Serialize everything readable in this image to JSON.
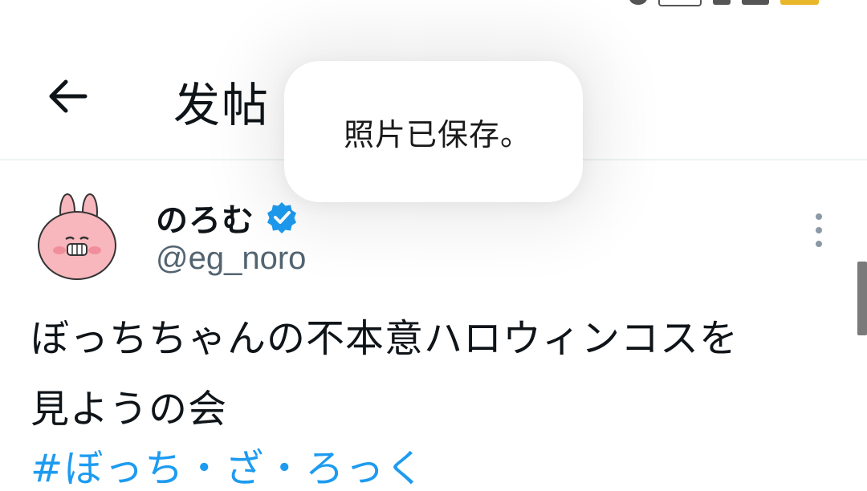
{
  "header": {
    "title": "发帖",
    "back_icon": "arrow-left-icon"
  },
  "toast": {
    "message": "照片已保存。"
  },
  "tweet": {
    "author": {
      "display_name": "のろむ",
      "handle": "@eg_noro",
      "verified": true,
      "verified_color": "#1d9bf0"
    },
    "text_line1": "ぼっちちゃんの不本意ハロウィンコスを",
    "text_line2": "見ようの会",
    "hashtag": "#ぼっち・ざ・ろっく",
    "hashtag_color": "#1d9bf0",
    "more_icon": "more-vertical-icon"
  }
}
